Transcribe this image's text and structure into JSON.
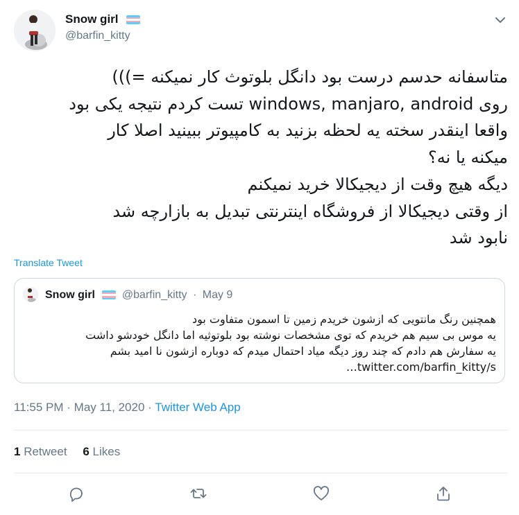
{
  "author": {
    "display_name": "Snow girl",
    "handle": "@barfin_kitty",
    "flag_colors": [
      "#5BCEFA",
      "#F5A9B8",
      "#FFFFFF",
      "#F5A9B8",
      "#5BCEFA"
    ]
  },
  "tweet": {
    "lines": [
      "متاسفانه حدسم درست بود دانگل بلوتوث کار نمیکنه =)))",
      "روی windows, manjaro, android تست کردم نتیجه یکی بود",
      "واقعا اینقدر سخته یه لحظه بزنید به کامپیوتر ببینید اصلا کار",
      "میکنه یا نه؟",
      "دیگه هیچ وقت از دیجیکالا خرید نمیکنم",
      "از وقتی دیجیکالا از فروشگاه اینترنتی تبدیل به بازارچه شد",
      "نابود شد"
    ],
    "translate_label": "Translate Tweet"
  },
  "quoted": {
    "display_name": "Snow girl",
    "handle": "@barfin_kitty",
    "separator": "·",
    "date": "May 9",
    "lines": [
      "همچنین رنگ مانتویی که ازشون خریدم زمین تا اسمون متفاوت بود",
      "یه موس بی سیم هم خریدم که توی مشخصات نوشته بود بلوتوثیه اما دانگل خودشو داشت",
      "یه سفارش هم دادم که چند روز دیگه میاد احتمال میدم که دوباره ازشون نا امید بشم"
    ],
    "link": "…twitter.com/barfin_kitty/s"
  },
  "meta": {
    "time": "11:55 PM",
    "separator": "·",
    "date": "May 11, 2020",
    "source": "Twitter Web App"
  },
  "stats": {
    "retweets_count": "1",
    "retweets_label": "Retweet",
    "likes_count": "6",
    "likes_label": "Likes"
  },
  "icons": {
    "more": "chevron-down-icon",
    "reply": "reply-icon",
    "retweet": "retweet-icon",
    "like": "heart-icon",
    "share": "share-icon"
  },
  "colors": {
    "link": "#1b95e0",
    "muted": "#657786",
    "text": "#14171a",
    "border": "#ccd6dd"
  }
}
